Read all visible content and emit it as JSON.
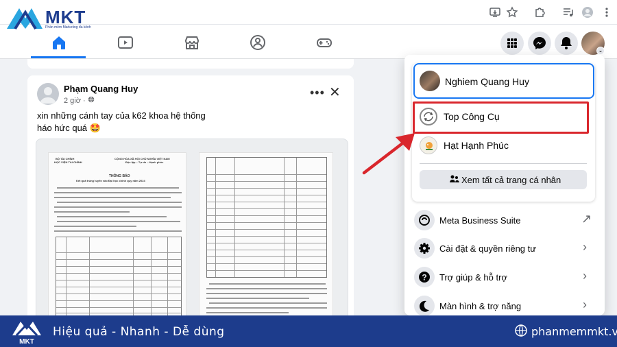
{
  "brand": {
    "logo_text": "MKT",
    "logo_sub": "Phần mềm Marketing đa kênh",
    "footer_slogan": "Hiệu quả - Nhanh - Dễ dùng",
    "footer_site": "phanmemmkt.vn",
    "footer_logo_text": "MKT",
    "colors": {
      "primary": "#1d3c8c",
      "accent": "#2aa6e0",
      "highlight": "#d9262c"
    }
  },
  "browser_toolbar": {
    "icons": [
      "install-app-icon",
      "bookmark-star-icon",
      "extensions-puzzle-icon",
      "media-control-icon",
      "profile-icon",
      "more-vert-icon"
    ]
  },
  "nav": {
    "tabs": [
      "home",
      "video",
      "marketplace",
      "groups",
      "gaming"
    ],
    "active": "home",
    "right_icons": [
      "menu-grid-icon",
      "messenger-icon",
      "notifications-bell-icon",
      "account-avatar"
    ]
  },
  "post": {
    "author": "Phạm Quang Huy",
    "time": "2 giờ ·",
    "text_line1": "xin những cánh tay của k62 khoa hệ thống",
    "text_line2": "háo hức quá 🤩",
    "doc1": {
      "header_left": "BỘ TÀI CHÍNH",
      "header_left2": "HỌC VIỆN TÀI CHÍNH",
      "header_right": "CỘNG HÒA XÃ HỘI CHỦ NGHĨA VIỆT NAM",
      "header_right2": "Độc lập – Tự do – Hạnh phúc",
      "title": "THÔNG BÁO",
      "subtitle": "Kết quả trúng tuyển vào Đại học chính quy năm 2024"
    },
    "doc2": {
      "col_headers": [
        "TT",
        "Mã ngành/ chuyên ngành",
        "Tên ngành/chuyên ngành",
        "Xét tuyển HSG dựa vào KQHT THPT"
      ]
    }
  },
  "account_menu": {
    "current_account": "Nghiem Quang Huy",
    "accounts": [
      "Top Công Cụ",
      "Hạt Hạnh Phúc"
    ],
    "see_all": "Xem tất cả trang cá nhân",
    "items": [
      {
        "label": "Meta Business Suite",
        "icon": "meta-business-icon",
        "trail": "↗"
      },
      {
        "label": "Cài đặt & quyền riêng tư",
        "icon": "settings-gear-icon",
        "trail": "›"
      },
      {
        "label": "Trợ giúp & hỗ trợ",
        "icon": "help-question-icon",
        "trail": "›"
      },
      {
        "label": "Màn hình & trợ năng",
        "icon": "display-moon-icon",
        "trail": "›"
      }
    ]
  }
}
